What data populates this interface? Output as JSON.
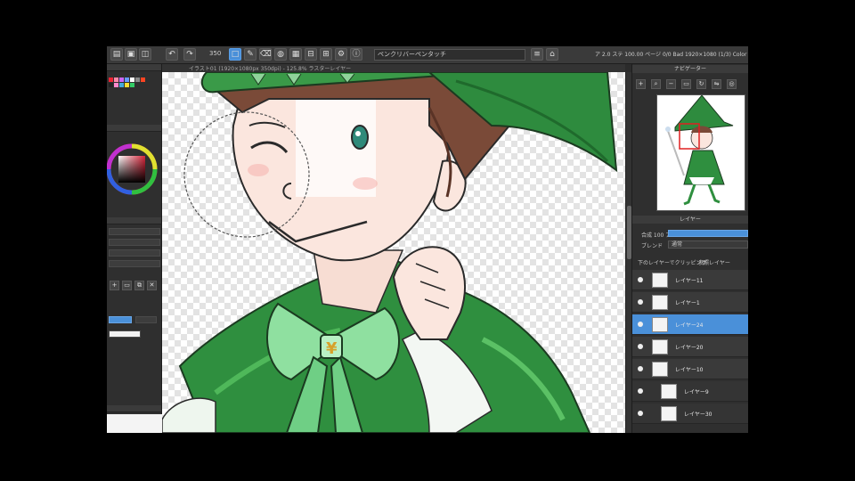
{
  "toolbar": {
    "brush_size": "350",
    "brush_selector": "ペンクリバーペンタッチ",
    "file_info": "ア 2.0 ステ 100.00 ページ 0/0 Bad 1920×1080 (1/3) Color"
  },
  "canvas_tab": {
    "title": "イラスト01 (1920×1080px 350dpi) - 125.8% ラスターレイヤー"
  },
  "navigator": {
    "title": "ナビゲーター"
  },
  "layer_panel": {
    "title": "レイヤー",
    "opacity_label": "合成 100 ア",
    "blend_label": "ブレンド",
    "blend_value": "通常",
    "clip_label": "下のレイヤーでクリッピング",
    "reference_label": "参照レイヤー",
    "layers": [
      {
        "name": "レイヤー11",
        "active": false,
        "indent": false
      },
      {
        "name": "レイヤー1",
        "active": false,
        "indent": false
      },
      {
        "name": "レイヤー24",
        "active": true,
        "indent": false
      },
      {
        "name": "レイヤー20",
        "active": false,
        "indent": false
      },
      {
        "name": "レイヤー10",
        "active": false,
        "indent": false
      },
      {
        "name": "レイヤー9",
        "active": false,
        "indent": true
      },
      {
        "name": "レイヤー30",
        "active": false,
        "indent": true
      }
    ]
  },
  "colors": {
    "ui_dark": "#2f2f2f",
    "accent": "#4a90d9",
    "hat_green": "#2e8b3e",
    "skin": "#fbe6de",
    "hair": "#7a4a38"
  },
  "icons": [
    "undo-icon",
    "redo-icon",
    "pen-icon",
    "eraser-icon",
    "fill-icon",
    "eye-icon",
    "zoom-icon",
    "folder-icon"
  ]
}
